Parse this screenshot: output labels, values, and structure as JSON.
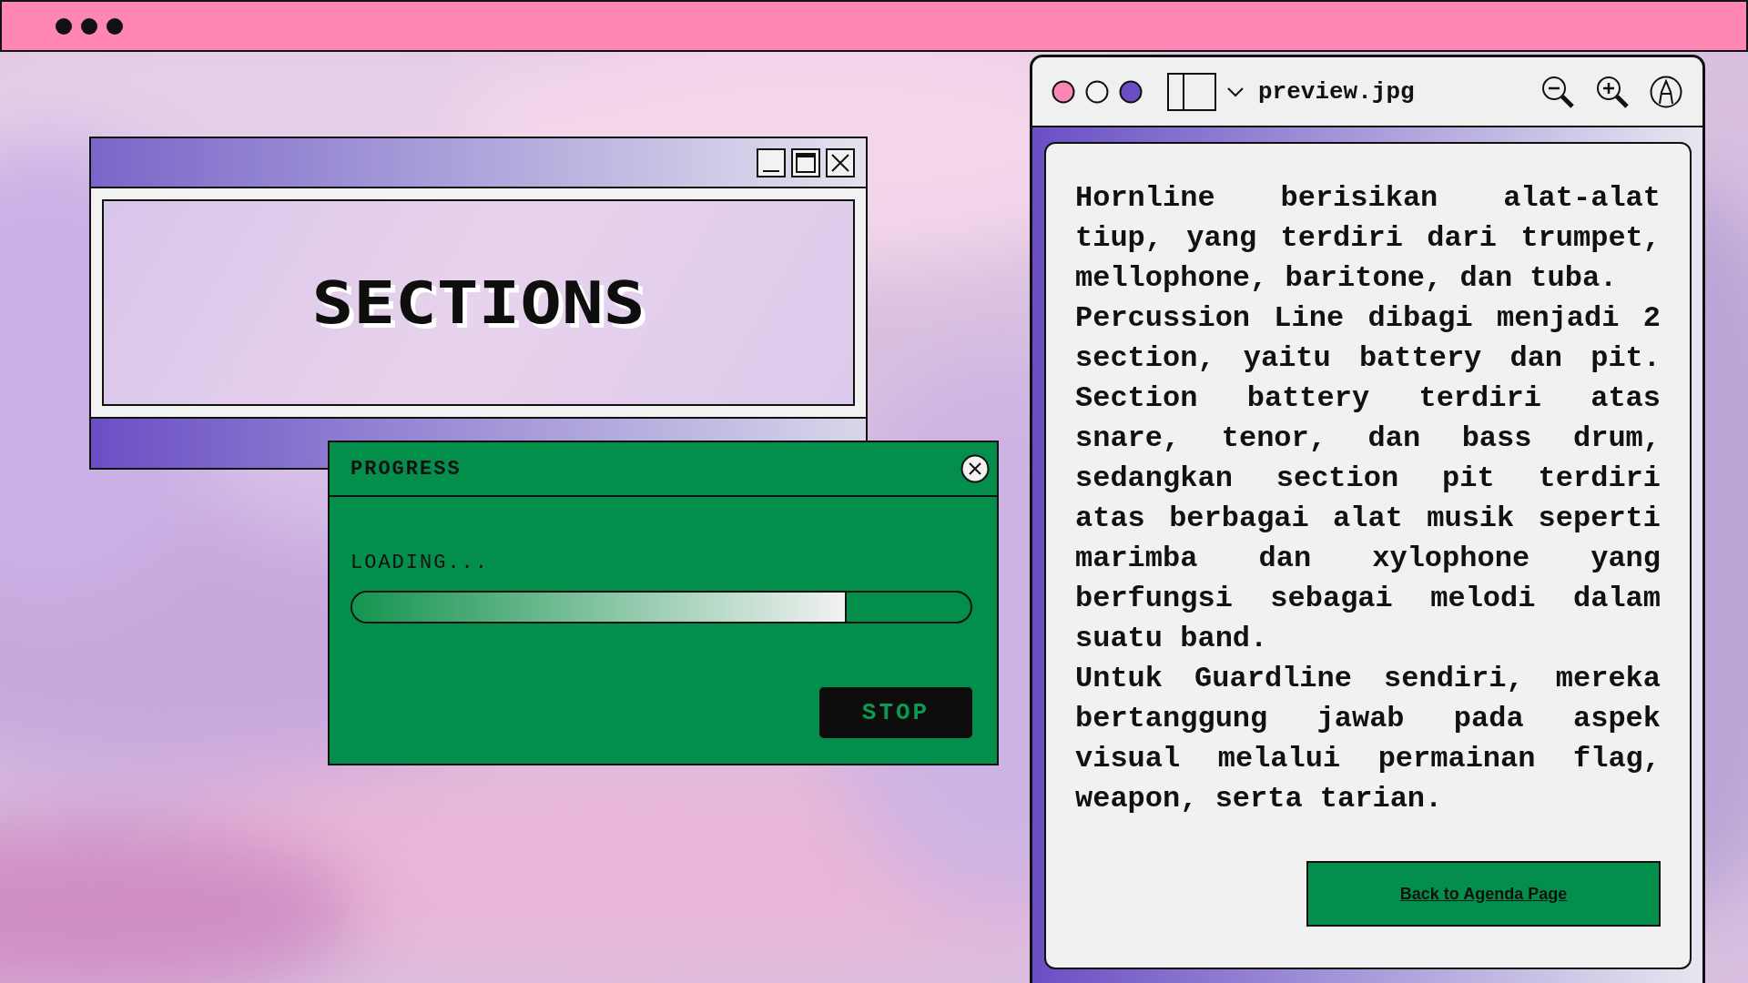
{
  "sections_window": {
    "title": "SECTIONS"
  },
  "progress_dialog": {
    "title": "PROGRESS",
    "status": "LOADING...",
    "level": 0.8,
    "stop_button": "STOP"
  },
  "preview_window": {
    "file_name": "preview.jpg",
    "paragraphs": [
      "Hornline berisikan alat-alat tiup, yang terdiri dari trumpet, mellophone, baritone, dan tuba.",
      "Percussion Line dibagi menjadi 2 section, yaitu battery dan pit. Section battery terdiri atas snare, tenor, dan bass drum, sedangkan section pit terdiri atas berbagai alat musik seperti marimba dan xylophone yang berfungsi sebagai melodi dalam suatu band.",
      "Untuk Guardline sendiri, mereka bertanggung jawab pada aspek visual melalui permainan flag, weapon, serta tarian."
    ],
    "link_button": "Back to Agenda Page"
  }
}
